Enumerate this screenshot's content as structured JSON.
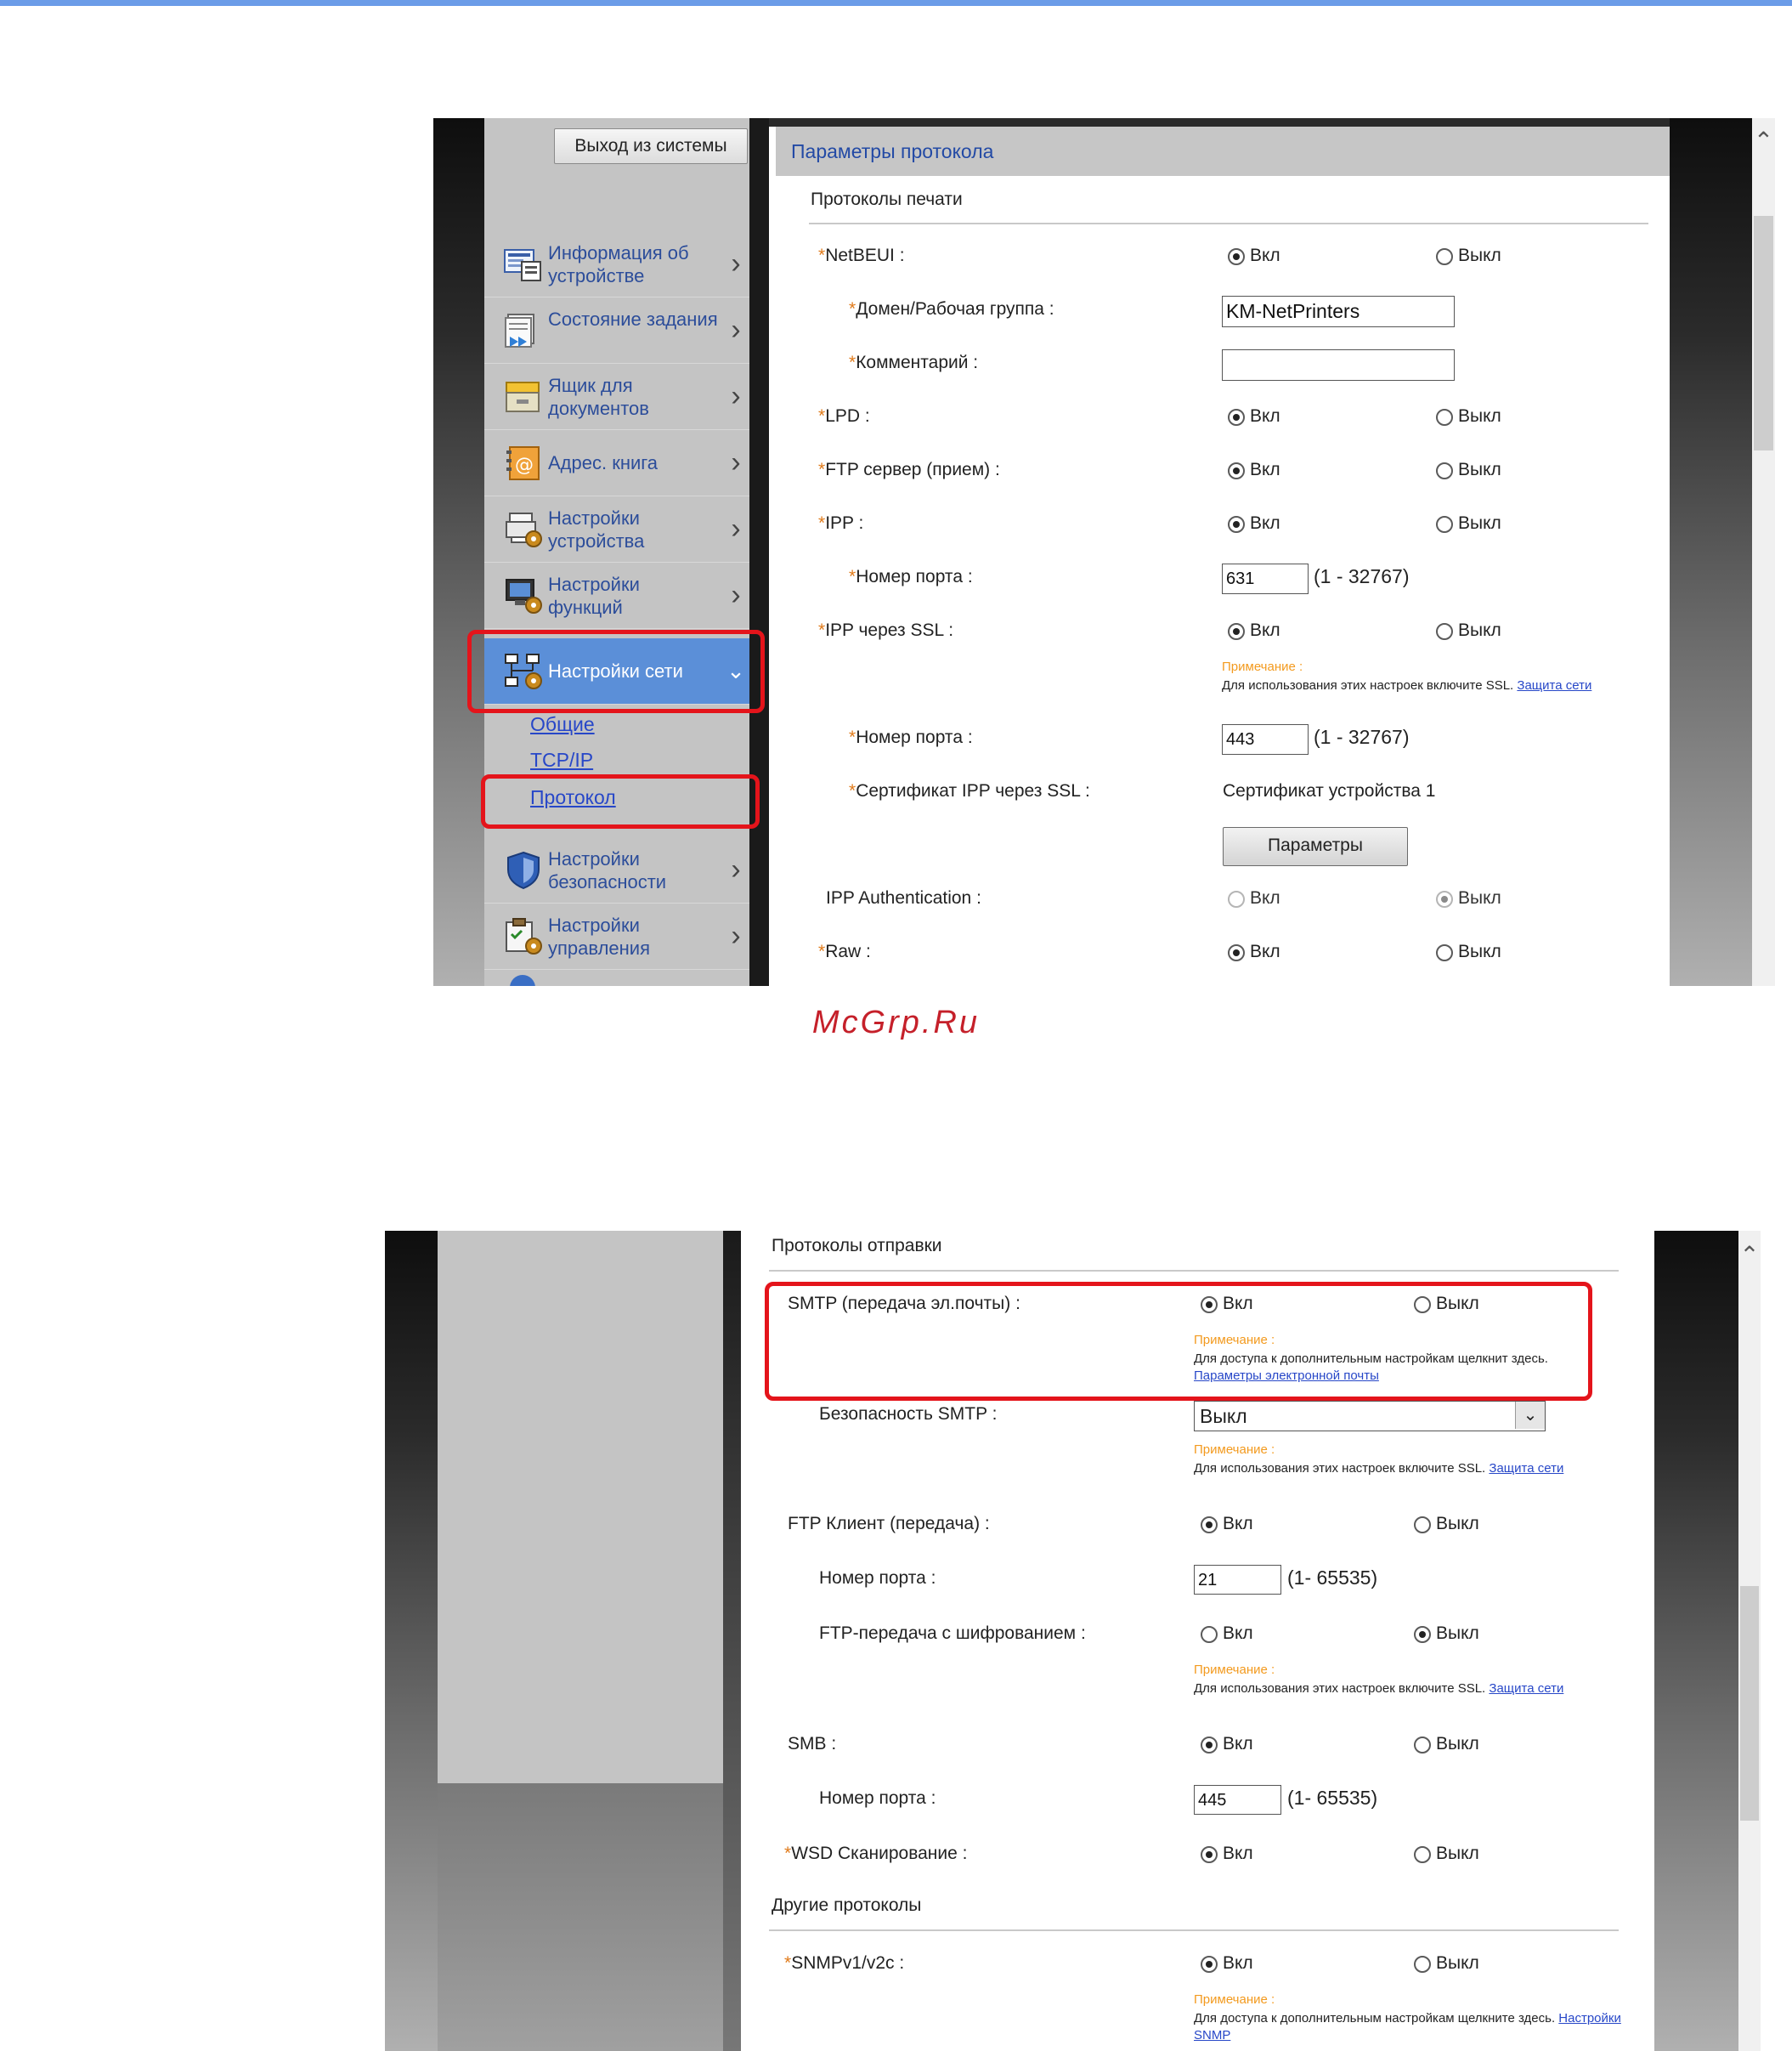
{
  "watermark": "McGrp.Ru",
  "shot1": {
    "logout_label": "Выход из системы",
    "menu": [
      {
        "label": "Информация об устройстве",
        "icon": "device-info-icon"
      },
      {
        "label": "Состояние задания",
        "icon": "job-status-icon"
      },
      {
        "label": "Ящик для документов",
        "icon": "document-box-icon"
      },
      {
        "label": "Адрес. книга",
        "icon": "address-book-icon"
      },
      {
        "label": "Настройки устройства",
        "icon": "device-settings-icon"
      },
      {
        "label": "Настройки функций",
        "icon": "function-settings-icon"
      },
      {
        "label": "Настройки сети",
        "icon": "network-settings-icon"
      },
      {
        "label": "Настройки безопасности",
        "icon": "security-settings-icon"
      },
      {
        "label": "Настройки управления",
        "icon": "management-settings-icon"
      }
    ],
    "submenu": [
      "Общие",
      "TCP/IP",
      "Протокол"
    ],
    "panel_title": "Параметры протокола",
    "section": "Протоколы печати",
    "on_label": "Вкл",
    "off_label": "Выкл",
    "rows": {
      "netbeui": "NetBEUI :",
      "domain": "Домен/Рабочая группа :",
      "domain_value": "KM-NetPrinters",
      "comment": "Комментарий :",
      "lpd": "LPD :",
      "ftp_server": "FTP сервер (прием) :",
      "ipp": "IPP :",
      "ipp_port": "Номер порта :",
      "ipp_port_value": "631",
      "ipp_range": "(1 - 32767)",
      "ipp_ssl": "IPP через SSL :",
      "note_title": "Примечание :",
      "note_ssl_text": "Для использования этих настроек включите SSL.",
      "note_ssl_link": "Защита сети",
      "ssl_port": "Номер порта :",
      "ssl_port_value": "443",
      "ssl_range": "(1 - 32767)",
      "ssl_cert": "Сертификат IPP через SSL :",
      "ssl_cert_value": "Сертификат устройства 1",
      "params_button": "Параметры",
      "ipp_auth": "IPP Authentication :",
      "raw": "Raw :"
    }
  },
  "shot2": {
    "section1": "Протоколы отправки",
    "on_label": "Вкл",
    "off_label": "Выкл",
    "note_title": "Примечание :",
    "smtp": "SMTP (передача эл.почты) :",
    "smtp_note_text": "Для доступа к дополнительным настройкам щелкнит здесь.",
    "smtp_note_link": "Параметры электронной почты",
    "smtp_security": "Безопасность SMTP :",
    "smtp_security_value": "Выкл",
    "ssl_note_text": "Для использования этих настроек включите SSL.",
    "ssl_note_link": "Защита сети",
    "ftp_client": "FTP Клиент (передача) :",
    "ftp_port": "Номер порта :",
    "ftp_port_value": "21",
    "ftp_range": "(1- 65535)",
    "ftp_encrypt": "FTP-передача с шифрованием :",
    "smb": "SMB :",
    "smb_port": "Номер порта :",
    "smb_port_value": "445",
    "smb_range": "(1- 65535)",
    "wsd": "WSD Сканирование :",
    "section2": "Другие протоколы",
    "snmp": "SNMPv1/v2c :",
    "snmp_note_text": "Для доступа к дополнительным настройкам щелкните здесь.",
    "snmp_note_link": "Настройки SNMP"
  }
}
